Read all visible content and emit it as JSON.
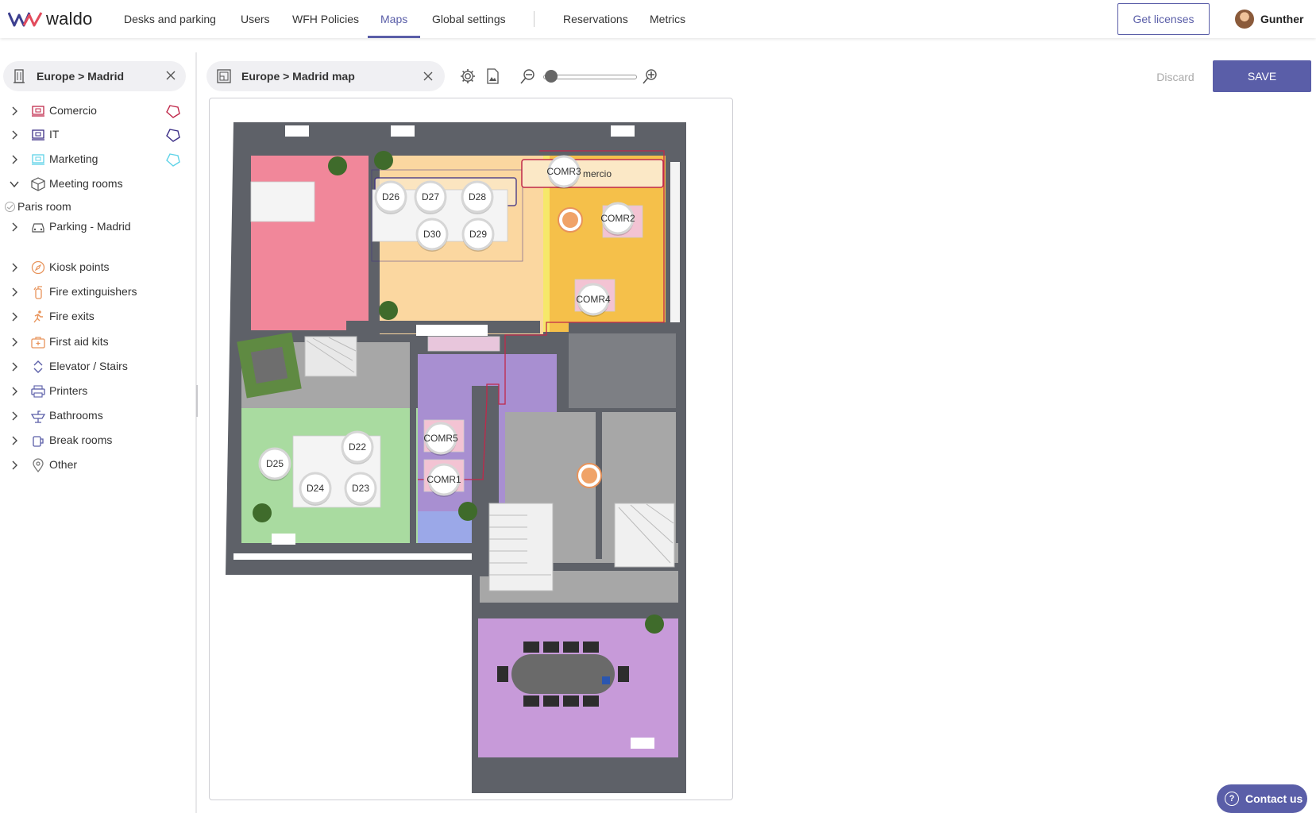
{
  "app": {
    "logo_text": "waldo"
  },
  "nav": {
    "items": [
      {
        "label": "Desks and parking"
      },
      {
        "label": "Users"
      },
      {
        "label": "WFH Policies"
      },
      {
        "label": "Maps"
      },
      {
        "label": "Global settings"
      },
      {
        "label": "Reservations"
      },
      {
        "label": "Metrics"
      }
    ],
    "active": "Maps",
    "get_licenses_label": "Get licenses",
    "user_name": "Gunther"
  },
  "left_panel": {
    "location": "Europe > Madrid",
    "tree": [
      {
        "label": "Comercio",
        "expanded": false,
        "icon": "desk-area-icon",
        "zone_color": "#c0284a"
      },
      {
        "label": "IT",
        "expanded": false,
        "icon": "desk-area-icon",
        "zone_color": "#3b2e86"
      },
      {
        "label": "Marketing",
        "expanded": false,
        "icon": "desk-area-icon",
        "zone_color": "#5fd3e8"
      },
      {
        "label": "Meeting rooms",
        "expanded": true,
        "icon": "cube-icon"
      },
      {
        "label": "Parking - Madrid",
        "expanded": false,
        "icon": "car-icon"
      },
      {
        "label": "Kiosk points",
        "expanded": false,
        "icon": "compass-icon"
      },
      {
        "label": "Fire extinguishers",
        "expanded": false,
        "icon": "extinguisher-icon"
      },
      {
        "label": "Fire exits",
        "expanded": false,
        "icon": "running-icon"
      },
      {
        "label": "First aid kits",
        "expanded": false,
        "icon": "first-aid-icon"
      },
      {
        "label": "Elevator / Stairs",
        "expanded": false,
        "icon": "elevator-icon"
      },
      {
        "label": "Printers",
        "expanded": false,
        "icon": "printer-icon"
      },
      {
        "label": "Bathrooms",
        "expanded": false,
        "icon": "sink-icon"
      },
      {
        "label": "Break rooms",
        "expanded": false,
        "icon": "mug-icon"
      },
      {
        "label": "Other",
        "expanded": false,
        "icon": "pin-icon"
      }
    ],
    "meeting_rooms": [
      {
        "label": "Paris room"
      }
    ]
  },
  "map_toolbar": {
    "map_name": "Europe > Madrid map",
    "zoom_level": 0.05,
    "discard_label": "Discard",
    "save_label": "SAVE"
  },
  "map": {
    "zone_labels": {
      "comercio_tag": "mercio"
    },
    "desks": [
      "D26",
      "D27",
      "D28",
      "D30",
      "D29",
      "D22",
      "D25",
      "D24",
      "D23"
    ],
    "meeting_markers": [
      "COMR3",
      "COMR2",
      "COMR4",
      "COMR5",
      "COMR1"
    ],
    "colors": {
      "wall": "#5e6168",
      "pink_zone": "#f1879a",
      "peach_zone": "#fbd7a0",
      "orange_zone": "#f5c04a",
      "purple_zone": "#a88fd1",
      "green_zone": "#a9dba0",
      "lilac_zone": "#c79ad9",
      "blue_zone": "#9ba8e8",
      "carpet": "#a7a7a7"
    }
  },
  "contact": {
    "label": "Contact us"
  },
  "accent_color": "#5a5ea8"
}
